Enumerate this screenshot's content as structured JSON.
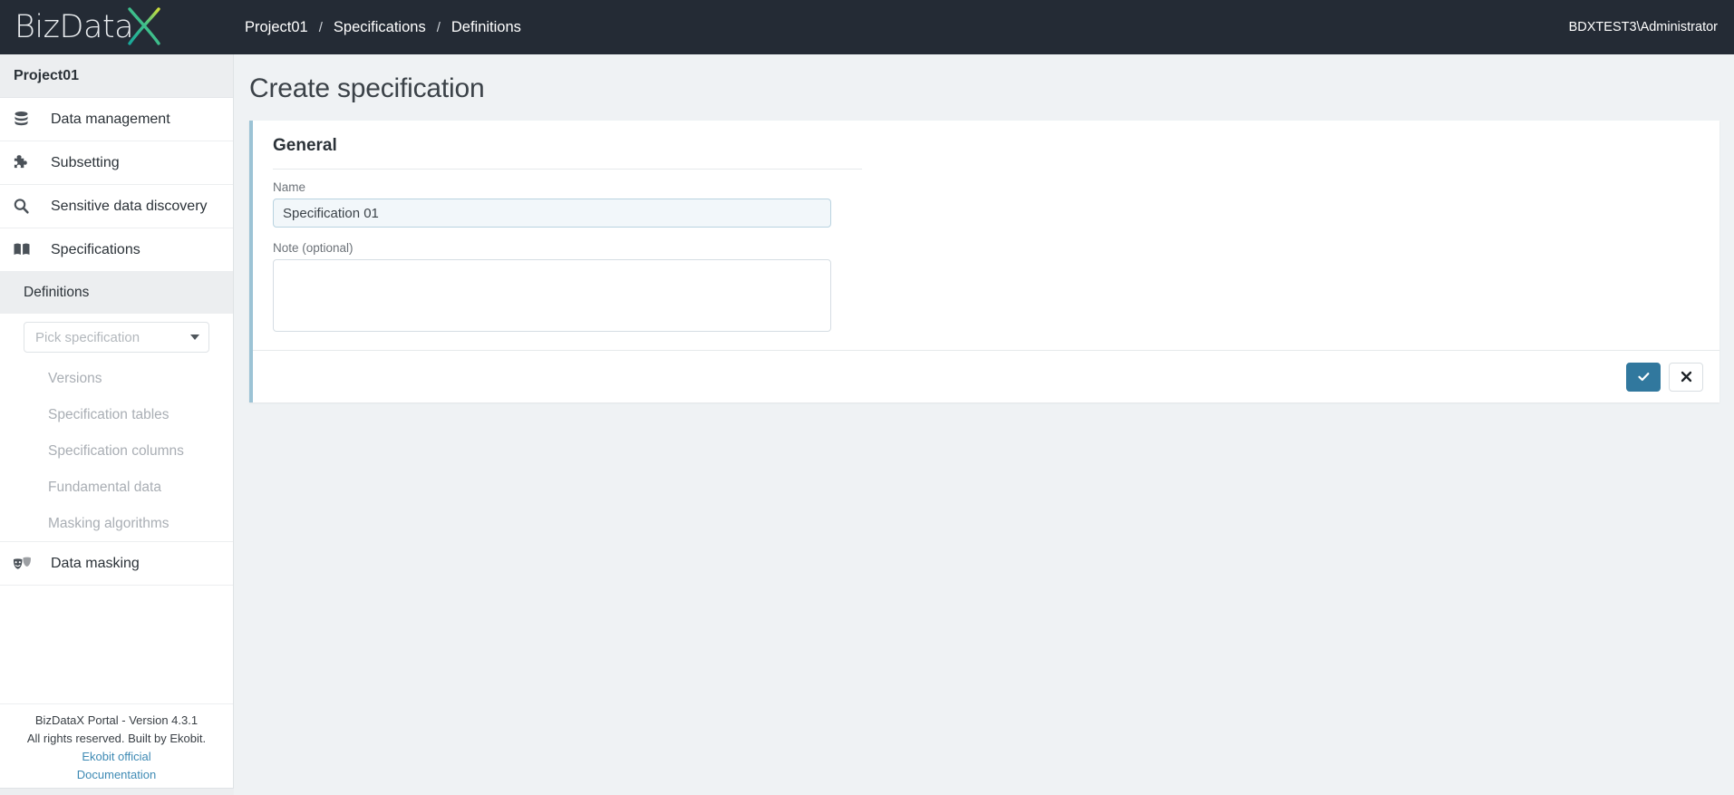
{
  "brand": {
    "name_part1": "BizData",
    "name_part2": "X",
    "logo_gradient_from": "#18a89b",
    "logo_gradient_to": "#cede3a"
  },
  "topbar": {
    "breadcrumb": [
      {
        "label": "Project01"
      },
      {
        "label": "Specifications"
      },
      {
        "label": "Definitions"
      }
    ],
    "separator": "/",
    "user": "BDXTEST3\\Administrator",
    "background": "#242b35"
  },
  "sidebar": {
    "project_name": "Project01",
    "items": [
      {
        "label": "Data management",
        "icon": "database-icon"
      },
      {
        "label": "Subsetting",
        "icon": "puzzle-piece-icon"
      },
      {
        "label": "Sensitive data discovery",
        "icon": "search-icon"
      },
      {
        "label": "Specifications",
        "icon": "book-icon"
      }
    ],
    "active_subsection": "Definitions",
    "picker": {
      "placeholder": "Pick specification",
      "icon": "chevron-down-icon"
    },
    "subitems": [
      {
        "label": "Versions"
      },
      {
        "label": "Specification tables"
      },
      {
        "label": "Specification columns"
      },
      {
        "label": "Fundamental data"
      },
      {
        "label": "Masking algorithms"
      }
    ],
    "last_item": {
      "label": "Data masking",
      "icon": "masks-icon"
    },
    "footer": {
      "line1": "BizDataX Portal - Version 4.3.1",
      "line2": "All rights reserved. Built by Ekobit.",
      "link1": "Ekobit official",
      "link2": "Documentation",
      "link_color": "#3e8ab4"
    }
  },
  "main": {
    "page_title": "Create specification",
    "card": {
      "accent_color": "#9cc3d5",
      "title": "General",
      "fields": [
        {
          "label": "Name",
          "value": "Specification 01",
          "placeholder": ""
        },
        {
          "label": "Note (optional)",
          "value": "",
          "placeholder": ""
        }
      ],
      "actions": {
        "confirm_icon": "check-icon",
        "cancel_icon": "close-icon",
        "confirm_color": "#31789e"
      }
    }
  }
}
